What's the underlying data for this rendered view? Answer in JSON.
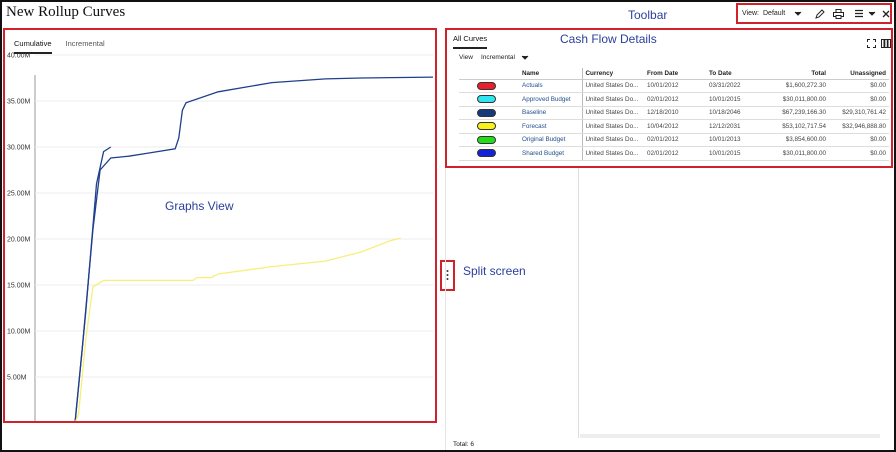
{
  "page": {
    "title": "New Rollup Curves"
  },
  "annotations": {
    "toolbar": "Toolbar",
    "cash_flow_details": "Cash Flow Details",
    "graphs_view": "Graphs View",
    "split_screen": "Split screen"
  },
  "toolbar": {
    "view_label": "View:",
    "view_value": "Default",
    "icons": [
      "chevron-down-icon",
      "pencil-icon",
      "print-icon",
      "menu-icon",
      "close-icon"
    ]
  },
  "graph": {
    "tabs": [
      "Cumulative",
      "Incremental"
    ],
    "active_tab": "Cumulative"
  },
  "chart_data": {
    "type": "line",
    "xlabel": "",
    "ylabel": "",
    "ylim": [
      0,
      40
    ],
    "y_ticks": [
      "5.00M",
      "10.00M",
      "15.00M",
      "20.00M",
      "25.00M",
      "30.00M",
      "35.00M",
      "40.00M"
    ],
    "series": [
      {
        "color": "#1f3f8c",
        "points": [
          [
            0.0,
            0
          ],
          [
            0.02,
            8
          ],
          [
            0.05,
            21
          ],
          [
            0.07,
            27.5
          ],
          [
            0.1,
            28.8
          ],
          [
            0.15,
            29
          ],
          [
            0.2,
            29.3
          ],
          [
            0.28,
            29.8
          ],
          [
            0.29,
            31
          ],
          [
            0.3,
            34
          ],
          [
            0.31,
            34.8
          ],
          [
            0.4,
            36
          ],
          [
            0.55,
            37
          ],
          [
            0.7,
            37.4
          ],
          [
            0.8,
            37.5
          ],
          [
            1.0,
            37.6
          ]
        ]
      },
      {
        "color": "#1f3f8c",
        "points": [
          [
            0.0,
            0
          ],
          [
            0.03,
            12
          ],
          [
            0.06,
            26
          ],
          [
            0.08,
            29.5
          ],
          [
            0.1,
            30
          ]
        ]
      },
      {
        "color": "#f5f07a",
        "points": [
          [
            0.0,
            0
          ],
          [
            0.01,
            1
          ],
          [
            0.03,
            9
          ],
          [
            0.05,
            14.8
          ],
          [
            0.08,
            15.5
          ],
          [
            0.2,
            15.5
          ],
          [
            0.33,
            15.5
          ],
          [
            0.34,
            15.8
          ],
          [
            0.38,
            15.8
          ],
          [
            0.4,
            16.2
          ],
          [
            0.55,
            17
          ],
          [
            0.7,
            17.6
          ],
          [
            0.8,
            18.6
          ],
          [
            0.88,
            19.8
          ],
          [
            0.91,
            20.1
          ]
        ]
      }
    ]
  },
  "details": {
    "tab": "All Curves",
    "view_label": "View",
    "view_value": "Incremental",
    "icons": [
      "expand-icon",
      "columns-icon"
    ],
    "columns": [
      "Name",
      "Currency",
      "From Date",
      "To Date",
      "Total",
      "Unassigned"
    ],
    "rows": [
      {
        "color": "#e8202a",
        "name": "Actuals",
        "currency": "United States Do...",
        "from": "10/01/2012",
        "to": "03/31/2022",
        "total": "$1,600,272.30",
        "unassigned": "$0.00"
      },
      {
        "color": "#2fe6f0",
        "name": "Approved Budget",
        "currency": "United States Do...",
        "from": "02/01/2012",
        "to": "10/01/2015",
        "total": "$30,011,800.00",
        "unassigned": "$0.00"
      },
      {
        "color": "#16397a",
        "name": "Baseline",
        "currency": "United States Do...",
        "from": "12/18/2010",
        "to": "10/18/2046",
        "total": "$67,239,166.30",
        "unassigned": "$29,310,761.42"
      },
      {
        "color": "#f7f21a",
        "name": "Forecast",
        "currency": "United States Do...",
        "from": "10/04/2012",
        "to": "12/12/2031",
        "total": "$53,102,717.54",
        "unassigned": "$32,946,888.80"
      },
      {
        "color": "#22dd1a",
        "name": "Original Budget",
        "currency": "United States Do...",
        "from": "02/01/2012",
        "to": "10/01/2013",
        "total": "$3,854,600.00",
        "unassigned": "$0.00"
      },
      {
        "color": "#1224d6",
        "name": "Shared Budget",
        "currency": "United States Do...",
        "from": "02/01/2012",
        "to": "10/01/2015",
        "total": "$30,011,800.00",
        "unassigned": "$0.00"
      }
    ],
    "total_label": "Total: 6"
  }
}
